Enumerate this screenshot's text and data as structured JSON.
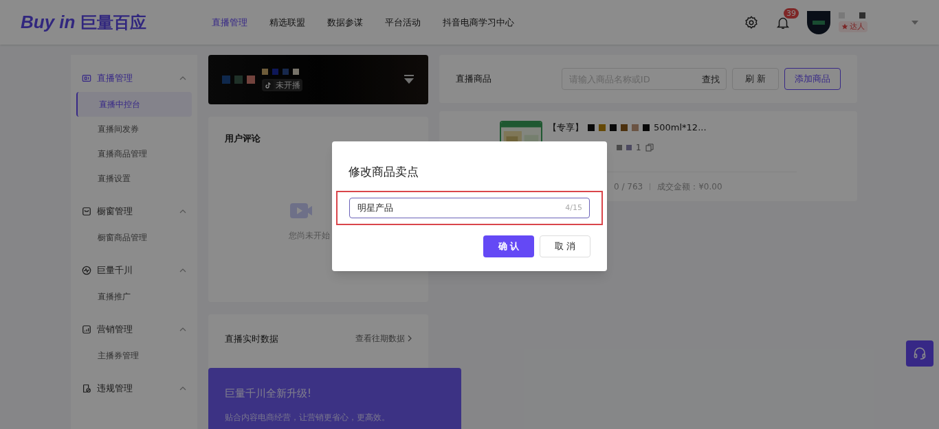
{
  "header": {
    "logo_latin": "Buy in",
    "logo_cjk": "巨量百应",
    "nav": [
      {
        "label": "直播管理",
        "selected": true
      },
      {
        "label": "精选联盟",
        "selected": false
      },
      {
        "label": "数据参谋",
        "selected": false
      },
      {
        "label": "平台活动",
        "selected": false
      },
      {
        "label": "抖音电商学习中心",
        "selected": false
      }
    ],
    "notification_count": "39",
    "role_tag": "达人"
  },
  "sidebar": [
    {
      "label": "直播管理",
      "kind": "live",
      "expanded": true,
      "children": [
        {
          "label": "直播中控台",
          "selected": true
        },
        {
          "label": "直播间发券",
          "selected": false
        },
        {
          "label": "直播商品管理",
          "selected": false
        },
        {
          "label": "直播设置",
          "selected": false
        }
      ]
    },
    {
      "label": "橱窗管理",
      "kind": "bag",
      "expanded": true,
      "children": [
        {
          "label": "橱窗商品管理",
          "selected": false
        }
      ]
    },
    {
      "label": "巨量千川",
      "kind": "pulse",
      "expanded": true,
      "children": [
        {
          "label": "直播推广",
          "selected": false
        }
      ]
    },
    {
      "label": "营销管理",
      "kind": "chart",
      "expanded": true,
      "children": [
        {
          "label": "主播券管理",
          "selected": false
        }
      ]
    },
    {
      "label": "违规管理",
      "kind": "doc",
      "expanded": true
    }
  ],
  "live_card": {
    "status": "未开播"
  },
  "comments": {
    "title": "用户评论",
    "empty_text": "您尚未开始"
  },
  "realtime": {
    "title": "直播实时数据",
    "link": "查看往期数据"
  },
  "promo": {
    "title": "巨量千川全新升级!",
    "text": "贴合内容电商经营，让营销更省心，更高效。"
  },
  "products": {
    "title": "直播商品",
    "search_placeholder": "请输入商品名称或ID",
    "search_button": "查找",
    "refresh_button": "刷 新",
    "add_button": "添加商品",
    "items": [
      {
        "title_prefix": "【专享】",
        "title_suffix": "500ml*12...",
        "id_tail": "1",
        "stock": "0 / 763",
        "amount": "成交金额：¥0.00"
      }
    ]
  },
  "dialog": {
    "title": "修改商品卖点",
    "value": "明星产品",
    "counter": "4/15",
    "highlighted": true,
    "confirm": "确 认",
    "cancel": "取 消"
  }
}
